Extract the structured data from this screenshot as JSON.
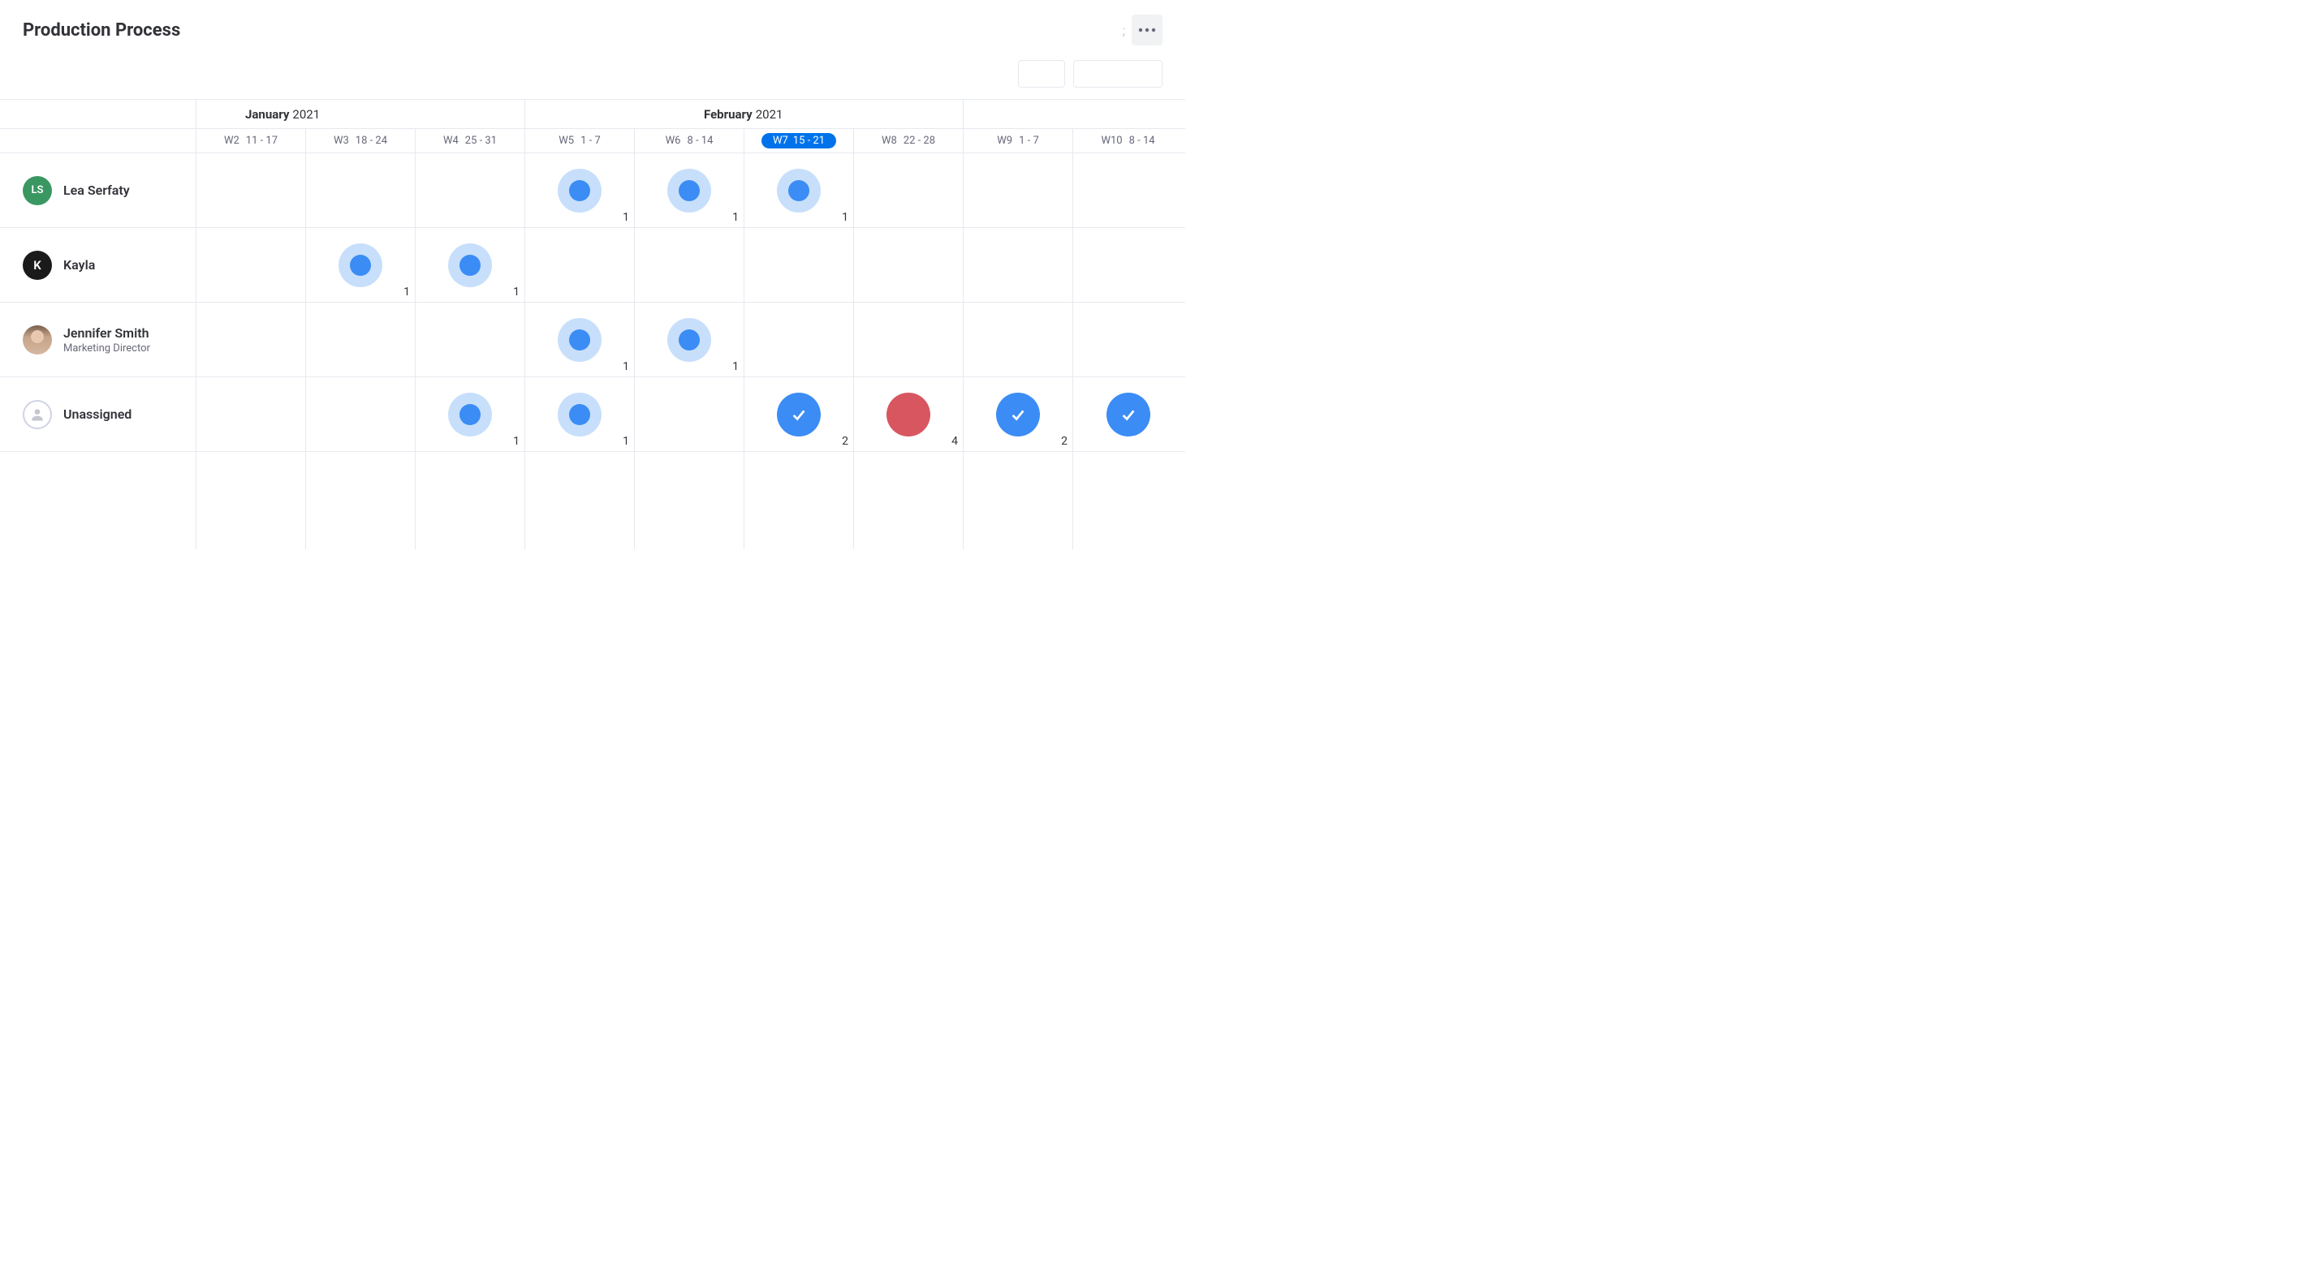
{
  "title": "Production Process",
  "months": [
    {
      "name": "January",
      "year": "2021"
    },
    {
      "name": "February",
      "year": "2021"
    },
    {
      "name": "",
      "year": ""
    }
  ],
  "weeks": [
    {
      "wk": "W2",
      "range": "11 - 17",
      "current": false
    },
    {
      "wk": "W3",
      "range": "18 - 24",
      "current": false
    },
    {
      "wk": "W4",
      "range": "25 - 31",
      "current": false
    },
    {
      "wk": "W5",
      "range": "1 - 7",
      "current": false
    },
    {
      "wk": "W6",
      "range": "8 - 14",
      "current": false
    },
    {
      "wk": "W7",
      "range": "15 - 21",
      "current": true
    },
    {
      "wk": "W8",
      "range": "22 - 28",
      "current": false
    },
    {
      "wk": "W9",
      "range": "1 - 7",
      "current": false
    },
    {
      "wk": "W10",
      "range": "8 - 14",
      "current": false
    }
  ],
  "people": [
    {
      "name": "Lea Serfaty",
      "subtitle": "",
      "avatar": {
        "type": "initials",
        "text": "LS",
        "class": "ls"
      },
      "cells": [
        null,
        null,
        null,
        {
          "style": "ring",
          "count": "1"
        },
        {
          "style": "ring",
          "count": "1"
        },
        {
          "style": "ring",
          "count": "1"
        },
        null,
        null,
        null
      ]
    },
    {
      "name": "Kayla",
      "subtitle": "",
      "avatar": {
        "type": "initials",
        "text": "K",
        "class": "k"
      },
      "cells": [
        null,
        {
          "style": "ring",
          "count": "1"
        },
        {
          "style": "ring",
          "count": "1"
        },
        null,
        null,
        null,
        null,
        null,
        null
      ]
    },
    {
      "name": "Jennifer Smith",
      "subtitle": "Marketing Director",
      "avatar": {
        "type": "photo",
        "text": "",
        "class": "photo"
      },
      "cells": [
        null,
        null,
        null,
        {
          "style": "ring",
          "count": "1"
        },
        {
          "style": "ring",
          "count": "1"
        },
        null,
        null,
        null,
        null
      ]
    },
    {
      "name": "Unassigned",
      "subtitle": "",
      "avatar": {
        "type": "unassigned",
        "text": "",
        "class": "unassigned"
      },
      "cells": [
        null,
        null,
        {
          "style": "ring",
          "count": "1"
        },
        {
          "style": "ring",
          "count": "1"
        },
        null,
        {
          "style": "check-blue",
          "count": "2"
        },
        {
          "style": "solid-red",
          "count": "4"
        },
        {
          "style": "check-blue",
          "count": "2"
        },
        {
          "style": "check-blue",
          "count": ""
        }
      ]
    }
  ]
}
